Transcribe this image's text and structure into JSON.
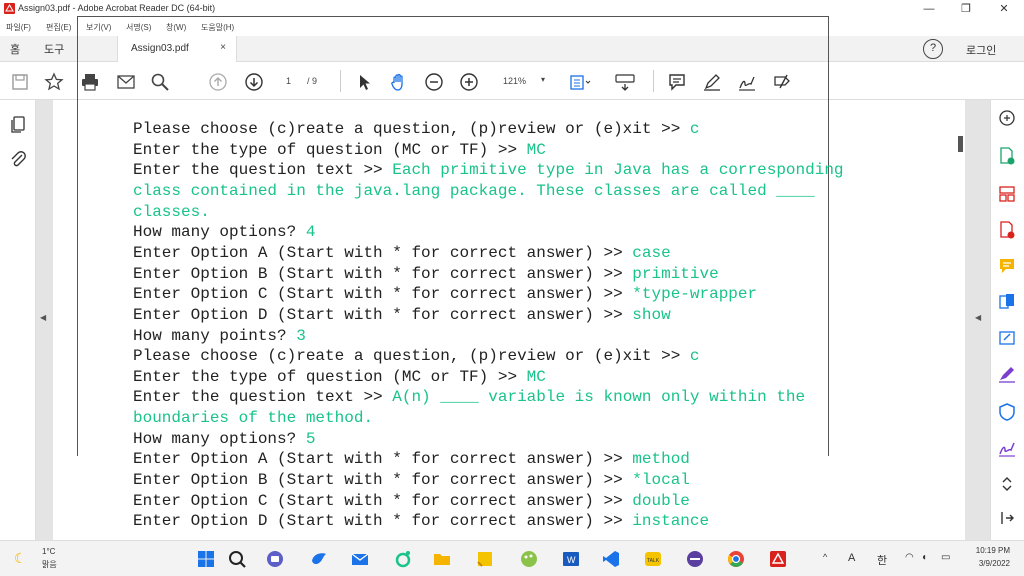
{
  "window": {
    "title": "Assign03.pdf - Adobe Acrobat Reader DC (64-bit)",
    "minimize": "—",
    "restore": "❐",
    "close": "✕"
  },
  "menu": [
    "파일(F)",
    "편집(E)",
    "보기(V)",
    "서명(S)",
    "창(W)",
    "도움말(H)"
  ],
  "tabs": {
    "home": "홈",
    "tools": "도구",
    "document": "Assign03.pdf",
    "close": "×",
    "help": "?",
    "login": "로그인"
  },
  "toolbar": {
    "page_current": "1",
    "page_total": "/ 9",
    "zoom": "121%",
    "zoom_caret": "▾"
  },
  "console_lines": [
    [
      {
        "t": "Please choose (c)reate a question, (p)review or (e)xit >> "
      },
      {
        "t": "c",
        "in": true
      }
    ],
    [
      {
        "t": "Enter the type of question (MC or TF) >> "
      },
      {
        "t": "MC",
        "in": true
      }
    ],
    [
      {
        "t": "Enter the question text >> "
      },
      {
        "t": "Each primitive type in Java has a corresponding",
        "in": true
      }
    ],
    [
      {
        "t": "class contained in the java.lang package. These classes are called ____",
        "in": true
      }
    ],
    [
      {
        "t": "classes.",
        "in": true
      }
    ],
    [
      {
        "t": "How many options? "
      },
      {
        "t": "4",
        "in": true
      }
    ],
    [
      {
        "t": "Enter Option A (Start with * for correct answer) >> "
      },
      {
        "t": "case",
        "in": true
      }
    ],
    [
      {
        "t": "Enter Option B (Start with * for correct answer) >> "
      },
      {
        "t": "primitive",
        "in": true
      }
    ],
    [
      {
        "t": "Enter Option C (Start with * for correct answer) >> "
      },
      {
        "t": "*type-wrapper",
        "in": true
      }
    ],
    [
      {
        "t": "Enter Option D (Start with * for correct answer) >> "
      },
      {
        "t": "show",
        "in": true
      }
    ],
    [
      {
        "t": "How many points? "
      },
      {
        "t": "3",
        "in": true
      }
    ],
    [
      {
        "t": "Please choose (c)reate a question, (p)review or (e)xit >> "
      },
      {
        "t": "c",
        "in": true
      }
    ],
    [
      {
        "t": "Enter the type of question (MC or TF) >> "
      },
      {
        "t": "MC",
        "in": true
      }
    ],
    [
      {
        "t": "Enter the question text >> "
      },
      {
        "t": "A(n) ____ variable is known only within the",
        "in": true
      }
    ],
    [
      {
        "t": "boundaries of the method.",
        "in": true
      }
    ],
    [
      {
        "t": "How many options? "
      },
      {
        "t": "5",
        "in": true
      }
    ],
    [
      {
        "t": "Enter Option A (Start with * for correct answer) >> "
      },
      {
        "t": "method",
        "in": true
      }
    ],
    [
      {
        "t": "Enter Option B (Start with * for correct answer) >> "
      },
      {
        "t": "*local",
        "in": true
      }
    ],
    [
      {
        "t": "Enter Option C (Start with * for correct answer) >> "
      },
      {
        "t": "double",
        "in": true
      }
    ],
    [
      {
        "t": "Enter Option D (Start with * for correct answer) >> "
      },
      {
        "t": "instance",
        "in": true
      }
    ]
  ],
  "taskbar": {
    "temperature": "1°C",
    "weather": "맑음",
    "ime_mode": "A",
    "ime_lang": "한",
    "time": "10:19 PM",
    "date": "3/9/2022"
  },
  "colors": {
    "input_text": "#19c38a",
    "acrobat_red": "#d9221c"
  }
}
